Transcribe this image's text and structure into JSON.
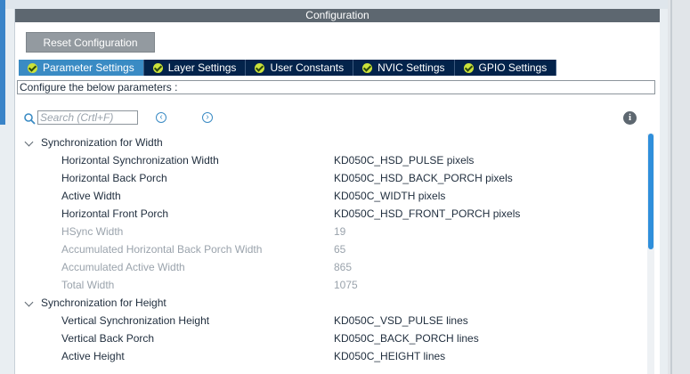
{
  "panel": {
    "title": "Configuration"
  },
  "reset_button": {
    "label": "Reset Configuration"
  },
  "tabs": [
    {
      "label": "Parameter Settings",
      "active": true
    },
    {
      "label": "Layer Settings",
      "active": false
    },
    {
      "label": "User Constants",
      "active": false
    },
    {
      "label": "NVIC Settings",
      "active": false
    },
    {
      "label": "GPIO Settings",
      "active": false
    }
  ],
  "hint": "Configure the below parameters :",
  "search": {
    "placeholder": "Search (Crtl+F)",
    "value": ""
  },
  "groups": [
    {
      "title": "Synchronization for Width",
      "params": [
        {
          "name": "Horizontal Synchronization Width",
          "value": "KD050C_HSD_PULSE pixels",
          "enabled": true
        },
        {
          "name": "Horizontal Back Porch",
          "value": "KD050C_HSD_BACK_PORCH pixels",
          "enabled": true
        },
        {
          "name": "Active Width",
          "value": "KD050C_WIDTH pixels",
          "enabled": true
        },
        {
          "name": "Horizontal Front Porch",
          "value": "KD050C_HSD_FRONT_PORCH pixels",
          "enabled": true
        },
        {
          "name": "HSync Width",
          "value": "19",
          "enabled": false
        },
        {
          "name": "Accumulated Horizontal Back Porch Width",
          "value": "65",
          "enabled": false
        },
        {
          "name": "Accumulated Active Width",
          "value": "865",
          "enabled": false
        },
        {
          "name": "Total Width",
          "value": "1075",
          "enabled": false
        }
      ]
    },
    {
      "title": "Synchronization for Height",
      "params": [
        {
          "name": "Vertical Synchronization Height",
          "value": "KD050C_VSD_PULSE lines",
          "enabled": true
        },
        {
          "name": "Vertical Back Porch",
          "value": "KD050C_BACK_PORCH lines",
          "enabled": true
        },
        {
          "name": "Active Height",
          "value": "KD050C_HEIGHT lines",
          "enabled": true
        }
      ]
    }
  ],
  "colors": {
    "tab_bg": "#03234b",
    "tab_active_bg": "#3a8bc4",
    "check_color": "#cbe23b",
    "title_bar": "#5d6770",
    "scroll_thumb": "#2f8fdb"
  }
}
